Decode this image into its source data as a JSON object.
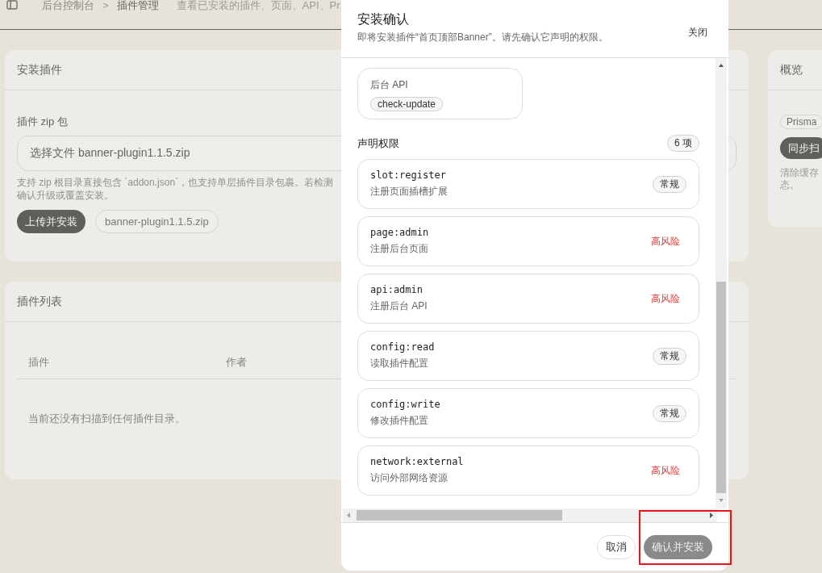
{
  "breadcrumb": {
    "items": [
      "后台控制台",
      "插件管理"
    ],
    "separator": ">",
    "description": "查看已安装的插件、页面、API、Pr"
  },
  "install_card": {
    "title": "安装插件",
    "field_label": "插件 zip 包",
    "file_field": {
      "value": "选择文件 banner-plugin1.1.5.zip"
    },
    "help": [
      "支持 zip 根目录直接包含 `addon.json`，也支持单层插件目录包裹。若检测",
      "确认升级或覆盖安装。"
    ],
    "upload_button": "上传并安装",
    "file_chip": "banner-plugin1.1.5.zip"
  },
  "list_card": {
    "title": "插件列表",
    "columns": [
      "插件",
      "作者"
    ],
    "empty": "当前还没有扫描到任何插件目录。"
  },
  "overview_card": {
    "title": "概览",
    "chip": "Prisma",
    "button": "同步扫",
    "note": [
      "清除缓存",
      "态。"
    ]
  },
  "dialog": {
    "title": "安装确认",
    "subtitle": "即将安装插件“首页顶部Banner”。请先确认它声明的权限。",
    "close": "关闭",
    "api_card": {
      "label": "后台 API",
      "chips": [
        "check-update"
      ]
    },
    "permissions_title": "声明权限",
    "permissions_count": "6 项",
    "permissions": [
      {
        "code": "slot:register",
        "description": "注册页面插槽扩展",
        "risk": "常规",
        "kind": "normal"
      },
      {
        "code": "page:admin",
        "description": "注册后台页面",
        "risk": "高风险",
        "kind": "high"
      },
      {
        "code": "api:admin",
        "description": "注册后台 API",
        "risk": "高风险",
        "kind": "high"
      },
      {
        "code": "config:read",
        "description": "读取插件配置",
        "risk": "常规",
        "kind": "normal"
      },
      {
        "code": "config:write",
        "description": "修改插件配置",
        "risk": "常规",
        "kind": "normal"
      },
      {
        "code": "network:external",
        "description": "访问外部网络资源",
        "risk": "高风险",
        "kind": "high"
      }
    ],
    "cancel": "取消",
    "confirm": {
      "label": "确认并安装",
      "disabled": true
    }
  }
}
